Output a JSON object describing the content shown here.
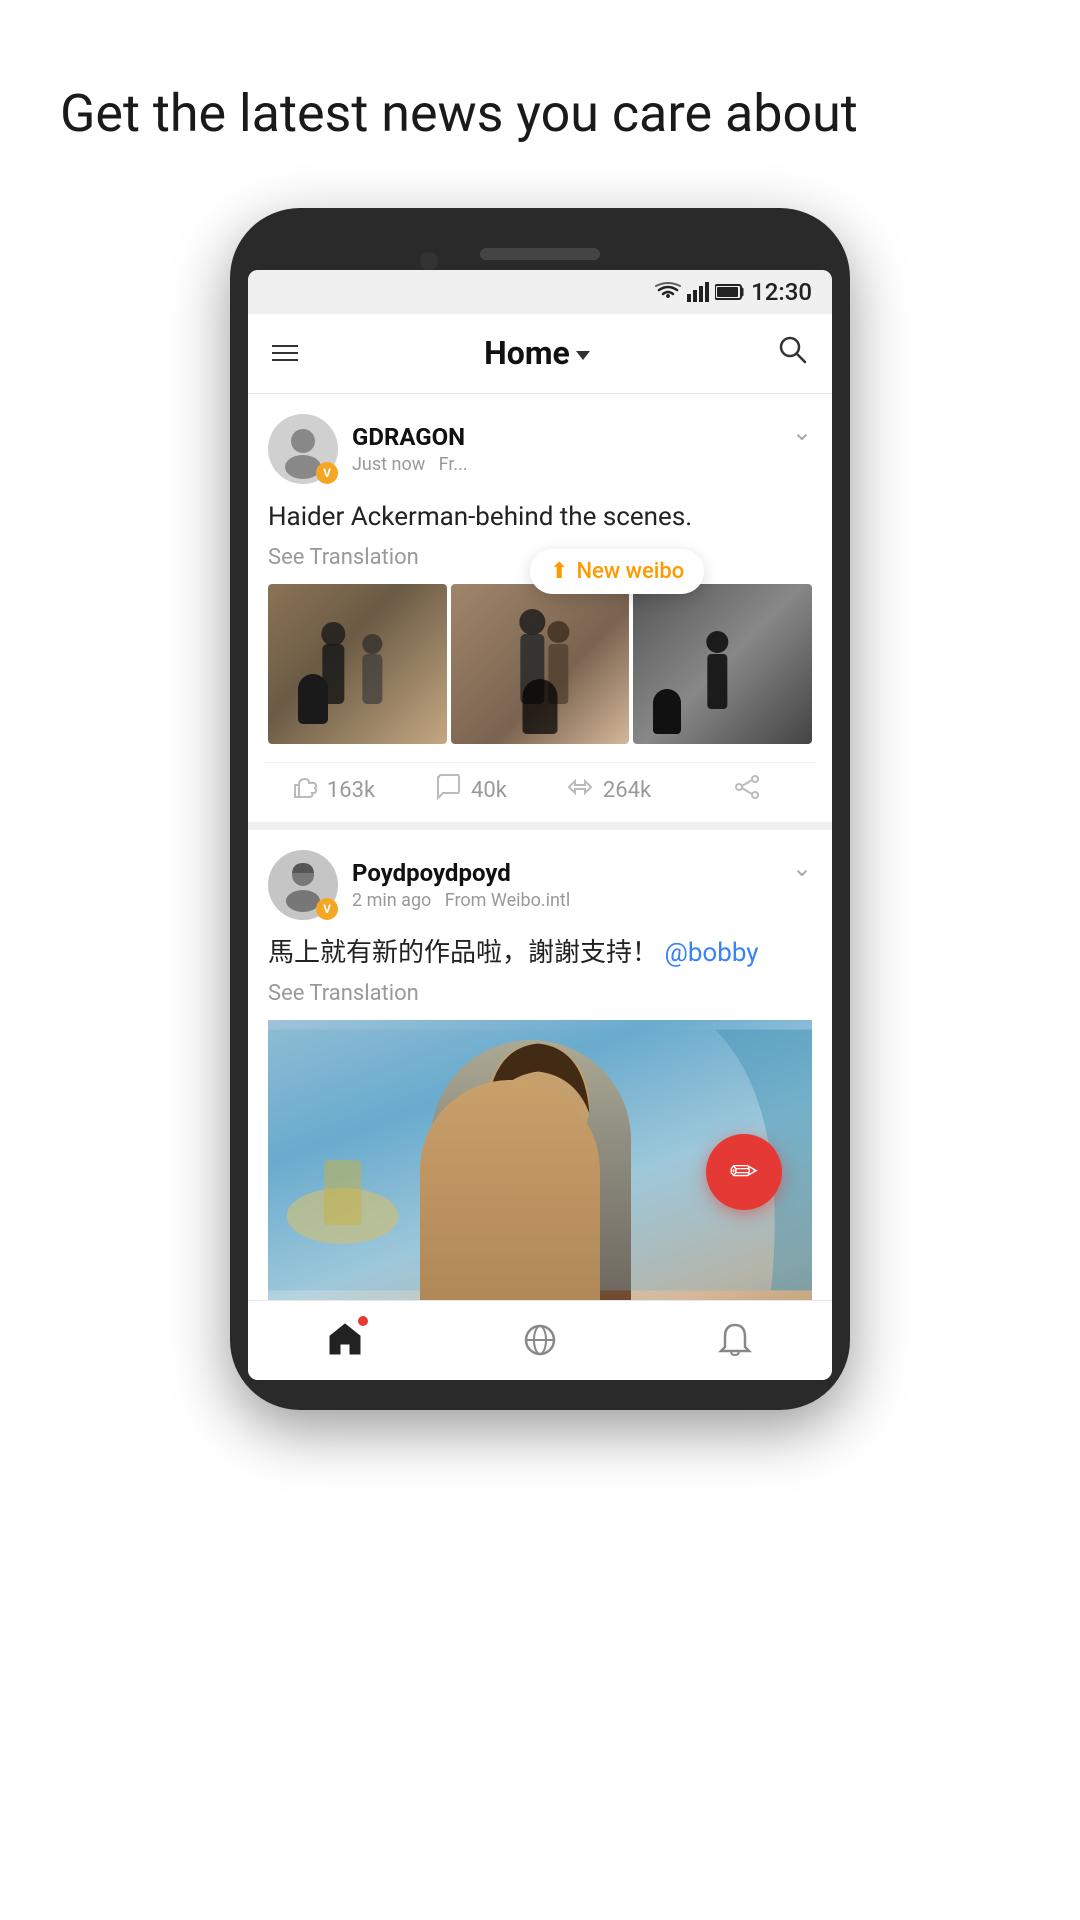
{
  "headline": "Get the latest news you care about",
  "status_bar": {
    "time": "12:30"
  },
  "nav": {
    "title": "Home",
    "dropdown_label": "Home ▾"
  },
  "new_weibo_toast": {
    "label": "New weibo"
  },
  "posts": [
    {
      "id": "post1",
      "username": "GDRAGON",
      "time": "Just now",
      "source": "Fr...",
      "content": "Haider Ackerman-behind the scenes.",
      "see_translation": "See Translation",
      "likes": "163k",
      "comments": "40k",
      "shares": "264k"
    },
    {
      "id": "post2",
      "username": "Poydpoydpoyd",
      "time": "2 min ago",
      "source": "From Weibo.intl",
      "content": "馬上就有新的作品啦，謝謝支持！",
      "mention": "@bobby",
      "see_translation": "See Translation"
    }
  ],
  "bottom_nav": {
    "home": "home",
    "discover": "discover",
    "notifications": "notifications"
  },
  "fab": {
    "icon": "✏"
  }
}
